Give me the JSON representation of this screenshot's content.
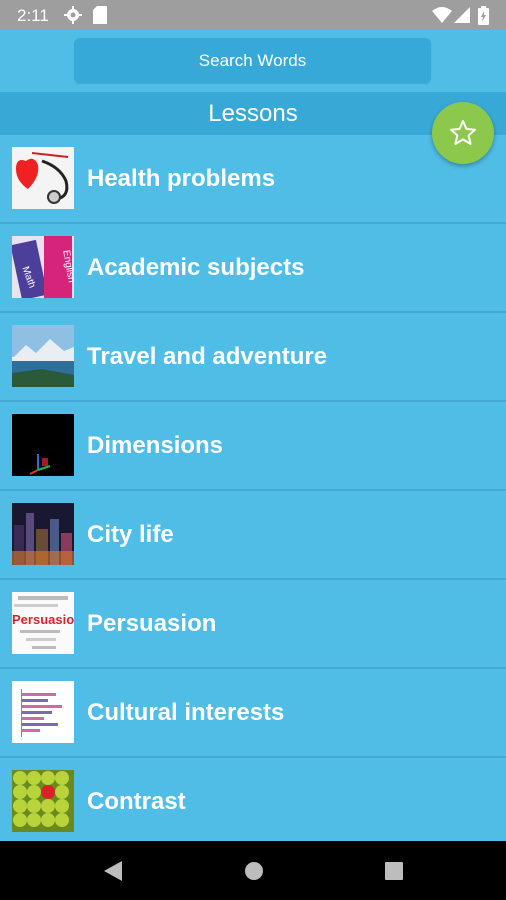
{
  "status_bar": {
    "time": "2:11",
    "icons": [
      "gear-icon",
      "sd-card-icon",
      "wifi-icon",
      "signal-icon",
      "battery-icon"
    ]
  },
  "search": {
    "label": "Search Words"
  },
  "section_title": "Lessons",
  "fab": {
    "icon": "star-icon",
    "color": "#8cc84b"
  },
  "lessons": [
    {
      "title": "Health problems",
      "thumb": "stethoscope-heart"
    },
    {
      "title": "Academic subjects",
      "thumb": "books-math-english"
    },
    {
      "title": "Travel and adventure",
      "thumb": "mountain-lake"
    },
    {
      "title": "Dimensions",
      "thumb": "dark-3d-axes"
    },
    {
      "title": "City life",
      "thumb": "city-night"
    },
    {
      "title": "Persuasion",
      "thumb": "persuasion-word-cloud"
    },
    {
      "title": "Cultural interests",
      "thumb": "bar-chart"
    },
    {
      "title": "Contrast",
      "thumb": "green-apples-one-red"
    }
  ],
  "nav_bar": {
    "icons": [
      "back-icon",
      "home-icon",
      "recents-icon"
    ]
  },
  "colors": {
    "background": "#4fbde6",
    "header": "#38a9d6",
    "status_bar": "#9e9e9e",
    "nav_bar": "#000000"
  }
}
